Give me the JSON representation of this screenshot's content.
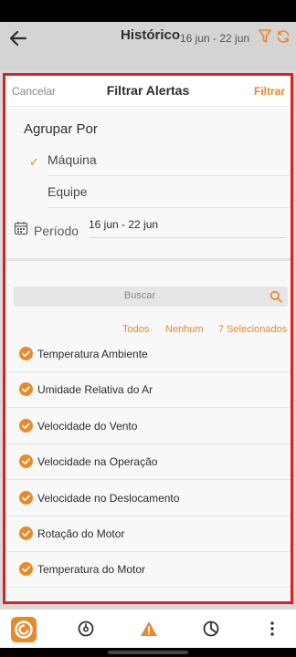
{
  "appbar": {
    "title": "Histórico",
    "date_range": "16 jun - 22 jun"
  },
  "modal": {
    "cancel_label": "Cancelar",
    "title": "Filtrar Alertas",
    "apply_label": "Filtrar",
    "group_by": {
      "label": "Agrupar Por",
      "options": [
        {
          "label": "Máquina",
          "selected": true
        },
        {
          "label": "Equipe",
          "selected": false
        }
      ]
    },
    "period": {
      "label": "Período",
      "value": "16 jun - 22 jun"
    },
    "search": {
      "placeholder": "Buscar"
    },
    "selection": {
      "all_label": "Todos",
      "none_label": "Nenhum",
      "count_label": "7 Selecionados"
    },
    "items": [
      {
        "label": "Temperatura Ambiente",
        "checked": true
      },
      {
        "label": "Umidade Relativa do Ar",
        "checked": true
      },
      {
        "label": "Velocidade do Vento",
        "checked": true
      },
      {
        "label": "Velocidade na Operação",
        "checked": true
      },
      {
        "label": "Velocidade no Deslocamento",
        "checked": true
      },
      {
        "label": "Rotação do Motor",
        "checked": true
      },
      {
        "label": "Temperatura do Motor",
        "checked": true
      }
    ]
  },
  "colors": {
    "accent": "#e8892b",
    "highlight_border": "#e11d1d"
  },
  "bottom_nav": {
    "items": [
      "logo-icon",
      "gauge-icon",
      "alert-icon",
      "pie-chart-icon",
      "more-vertical-icon"
    ]
  }
}
